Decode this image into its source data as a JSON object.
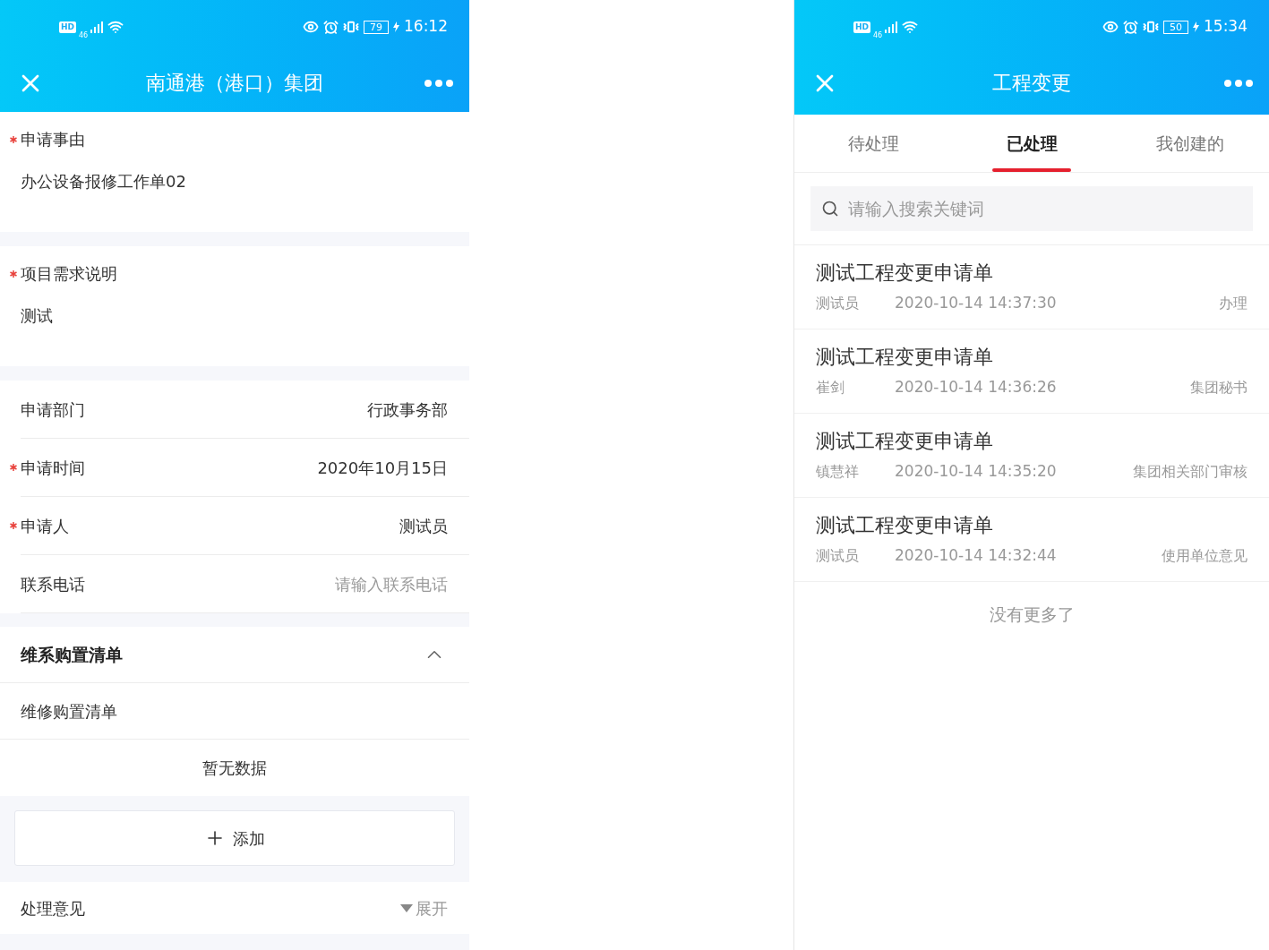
{
  "form_screen": {
    "status_bar": {
      "badges": [
        "HD",
        "46"
      ],
      "battery": "79",
      "time": "16:12"
    },
    "header": {
      "title": "南通港（港口）集团"
    },
    "groups": [
      {
        "fields": [
          {
            "kind": "block",
            "label": "申请事由",
            "required": true,
            "value": "办公设备报修工作单02"
          }
        ]
      },
      {
        "fields": [
          {
            "kind": "block",
            "label": "项目需求说明",
            "required": true,
            "value": "测试"
          }
        ]
      },
      {
        "fields": [
          {
            "kind": "row",
            "label": "申请部门",
            "required": false,
            "value": "行政事务部"
          },
          {
            "kind": "row",
            "label": "申请时间",
            "required": true,
            "value": "2020年10月15日"
          },
          {
            "kind": "row",
            "label": "申请人",
            "required": true,
            "value": "测试员"
          },
          {
            "kind": "input",
            "label": "联系电话",
            "required": false,
            "placeholder": "请输入联系电话"
          }
        ]
      }
    ],
    "section": {
      "title": "维系购置清单",
      "expanded": true,
      "subtitle": "维修购置清单",
      "empty_text": "暂无数据",
      "add_button": "添加"
    },
    "opinion": {
      "label": "处理意见",
      "toggle": "展开"
    }
  },
  "list_screen": {
    "status_bar": {
      "badges": [
        "HD",
        "46"
      ],
      "battery": "50",
      "time": "15:34"
    },
    "header": {
      "title": "工程变更"
    },
    "tabs": [
      {
        "label": "待处理",
        "selected": false
      },
      {
        "label": "已处理",
        "selected": true
      },
      {
        "label": "我创建的",
        "selected": false
      }
    ],
    "search": {
      "placeholder": "请输入搜索关键词"
    },
    "items": [
      {
        "title": "测试工程变更申请单",
        "person": "测试员",
        "time": "2020-10-14 14:37:30",
        "status": "办理"
      },
      {
        "title": "测试工程变更申请单",
        "person": "崔剑",
        "time": "2020-10-14 14:36:26",
        "status": "集团秘书"
      },
      {
        "title": "测试工程变更申请单",
        "person": "镇慧祥",
        "time": "2020-10-14 14:35:20",
        "status": "集团相关部门审核"
      },
      {
        "title": "测试工程变更申请单",
        "person": "测试员",
        "time": "2020-10-14 14:32:44",
        "status": "使用单位意见"
      }
    ],
    "footer": "没有更多了"
  }
}
